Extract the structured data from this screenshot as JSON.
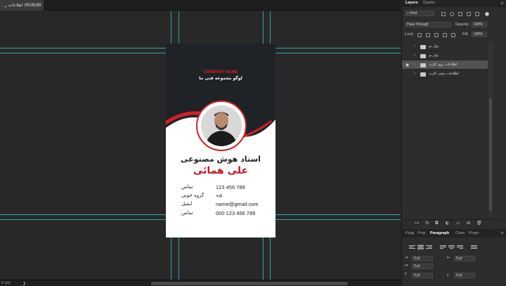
{
  "document_tab": {
    "title": ", اطلاعات ر (RGB/8)",
    "close": "×"
  },
  "status_bar": {
    "zoom": "0 pt)",
    "arrow": "❯"
  },
  "card": {
    "company_name": "COMPANY NAME",
    "subtitle": "لوگو مجموعه فنی ما",
    "job_title": "استاد هوش مصنوعی",
    "person_name": "علی همائی",
    "rows": [
      {
        "label": "تماس",
        "value": "123 456 789"
      },
      {
        "label": "گروه خونی",
        "value": "+A"
      },
      {
        "label": "ایمیل",
        "value": "name@gmail.com"
      },
      {
        "label": "تماس",
        "value": "000 123 456 789"
      }
    ],
    "colors": {
      "accent": "#d51f26",
      "dark": "#1f2226",
      "white": "#ffffff"
    }
  },
  "panel": {
    "tabs": [
      "Layers",
      "Glyphs"
    ],
    "menu_icon": "≡",
    "kind_label": "Kind",
    "blend_mode": "Pass Through",
    "opacity_label": "Opacity:",
    "opacity_value": "100%",
    "lock_label": "Lock:",
    "fill_label": "Fill:",
    "fill_value": "100%",
    "layers": [
      {
        "name": "نوار بم",
        "visible": false,
        "selected": false
      },
      {
        "name": "نوار بم",
        "visible": false,
        "selected": false
      },
      {
        "name": "اطلاعات روی کارت",
        "visible": true,
        "selected": true
      },
      {
        "name": "اطلاعات پشت کارت",
        "visible": false,
        "selected": false
      }
    ],
    "footer_icons": [
      "link-icon",
      "fx-icon",
      "mask-icon",
      "adjustment-icon",
      "folder-icon",
      "new-layer-icon",
      "trash-icon"
    ],
    "footer_labels": {
      "fx": "fx"
    },
    "para_tabs": [
      "Plugi",
      "Prop",
      "Paragraph",
      "Chon",
      "Props"
    ],
    "para_active": "Paragraph",
    "indent_values": [
      "0 pt",
      "0 pt",
      "0 pt",
      "0 pt",
      "0 pt"
    ]
  }
}
